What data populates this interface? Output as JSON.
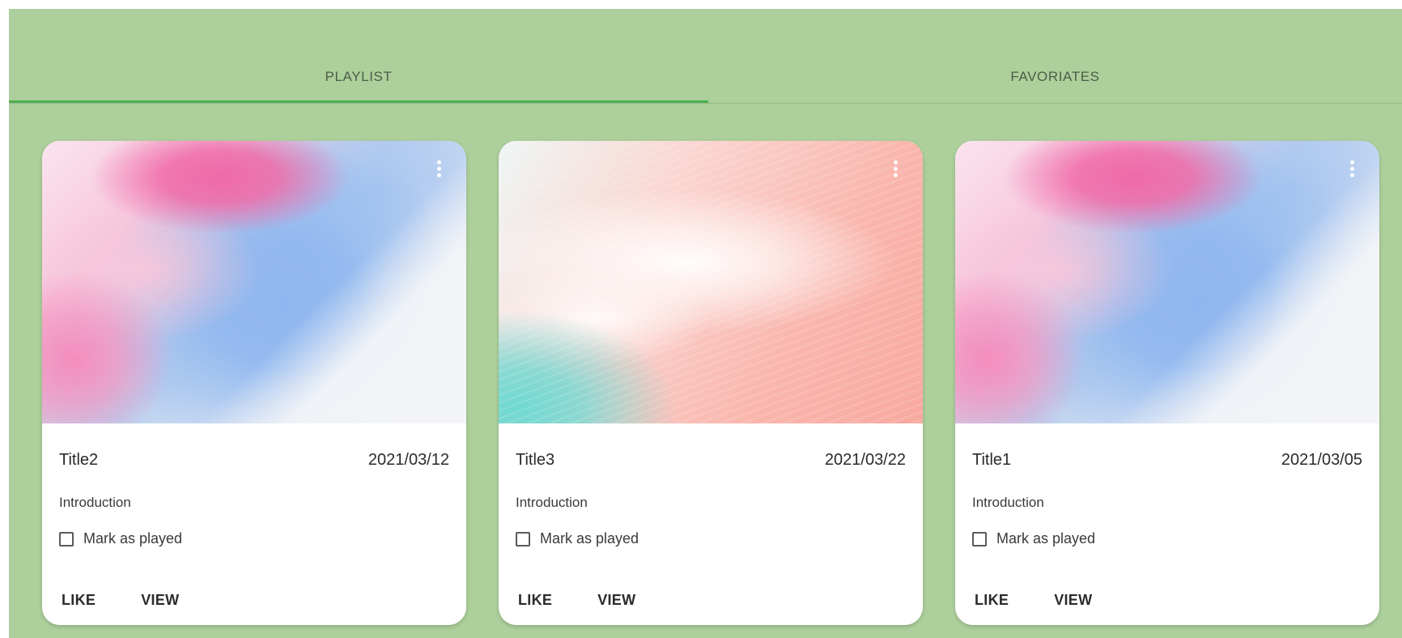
{
  "tabs": {
    "playlist_label": "PLAYLIST",
    "favorites_label": "FAVORIATES",
    "active": "playlist"
  },
  "colors": {
    "background": "#accf9b",
    "tab_indicator": "#4caf50",
    "card": "#ffffff"
  },
  "cards": [
    {
      "title": "Title2",
      "date": "2021/03/12",
      "description": "Introduction",
      "checkbox_label": "Mark as played",
      "checked": false,
      "like_label": "LIKE",
      "view_label": "VIEW",
      "image": "pink-blue-fluid-art",
      "menu_icon": "more-vert-icon"
    },
    {
      "title": "Title3",
      "date": "2021/03/22",
      "description": "Introduction",
      "checkbox_label": "Mark as played",
      "checked": false,
      "like_label": "LIKE",
      "view_label": "VIEW",
      "image": "teal-coral-brush-art",
      "menu_icon": "more-vert-icon"
    },
    {
      "title": "Title1",
      "date": "2021/03/05",
      "description": "Introduction",
      "checkbox_label": "Mark as played",
      "checked": false,
      "like_label": "LIKE",
      "view_label": "VIEW",
      "image": "pink-blue-fluid-art",
      "menu_icon": "more-vert-icon"
    }
  ]
}
